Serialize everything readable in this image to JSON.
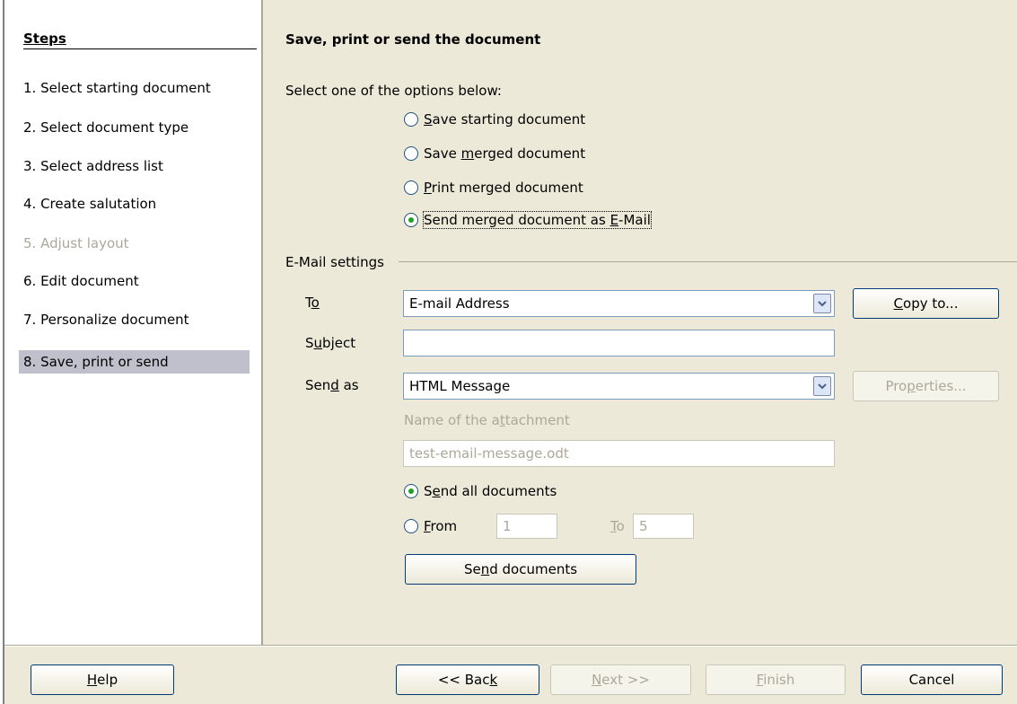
{
  "steps": {
    "title": "Steps",
    "items": [
      {
        "label": "1.  Select starting document"
      },
      {
        "label": "2.  Select document type"
      },
      {
        "label": "3.  Select address list"
      },
      {
        "label": "4.  Create salutation"
      },
      {
        "label": "5.  Adjust layout"
      },
      {
        "label": "6.  Edit document"
      },
      {
        "label": "7.  Personalize document"
      },
      {
        "label": "8.  Save, print or send"
      }
    ]
  },
  "content": {
    "title": "Save, print or send the document",
    "select_label": "Select one of the options below:",
    "options": [
      {
        "label": "Save starting document",
        "accel": "S",
        "rest": "ave starting document",
        "pre": ""
      },
      {
        "label": "Save merged document",
        "pre": "Save ",
        "accel": "m",
        "rest": "erged document"
      },
      {
        "label": "Print merged document",
        "pre": "",
        "accel": "P",
        "rest": "rint merged document"
      },
      {
        "label": "Send merged document as E-Mail",
        "pre": "Send merged document as ",
        "accel": "E",
        "rest": "-Mail",
        "checked": true
      }
    ]
  },
  "email": {
    "section_label": "E-Mail settings",
    "to_label_pre": "T",
    "to_label_accel": "o",
    "to_value": "E-mail Address",
    "copy_to_pre": "",
    "copy_to_accel": "C",
    "copy_to_rest": "opy to...",
    "subject_pre": "S",
    "subject_accel": "u",
    "subject_rest": "bject",
    "subject_value": "",
    "send_as_pre": "Sen",
    "send_as_accel": "d",
    "send_as_rest": " as",
    "send_as_value": "HTML Message",
    "properties_pre": "Pro",
    "properties_accel": "p",
    "properties_rest": "erties...",
    "attachment_label_pre": "Name of the a",
    "attachment_label_accel": "t",
    "attachment_label_rest": "tachment",
    "attachment_value": "test-email-message.odt",
    "send_all_pre": "S",
    "send_all_accel": "e",
    "send_all_rest": "nd all documents",
    "from_pre": "",
    "from_accel": "F",
    "from_rest": "rom",
    "from_value": "1",
    "to_range_accel": "T",
    "to_range_rest": "o",
    "to_range_value": "5",
    "send_docs_pre": "Se",
    "send_docs_accel": "n",
    "send_docs_rest": "d documents"
  },
  "footer": {
    "help_accel": "H",
    "help_rest": "elp",
    "back_pre": "<< Bac",
    "back_accel": "k",
    "back_rest": "",
    "next_accel": "N",
    "next_rest": "ext >>",
    "finish_accel": "F",
    "finish_rest": "inish",
    "cancel_label": "Cancel"
  },
  "colors": {
    "window_bg": "#ece9d8",
    "steps_bg": "#ffffff",
    "current_step_bg": "#c0c0cc",
    "disabled_text": "#aca899",
    "radio_dot": "#21a121"
  },
  "icons": {
    "dropdown": "chevron-down-icon"
  }
}
